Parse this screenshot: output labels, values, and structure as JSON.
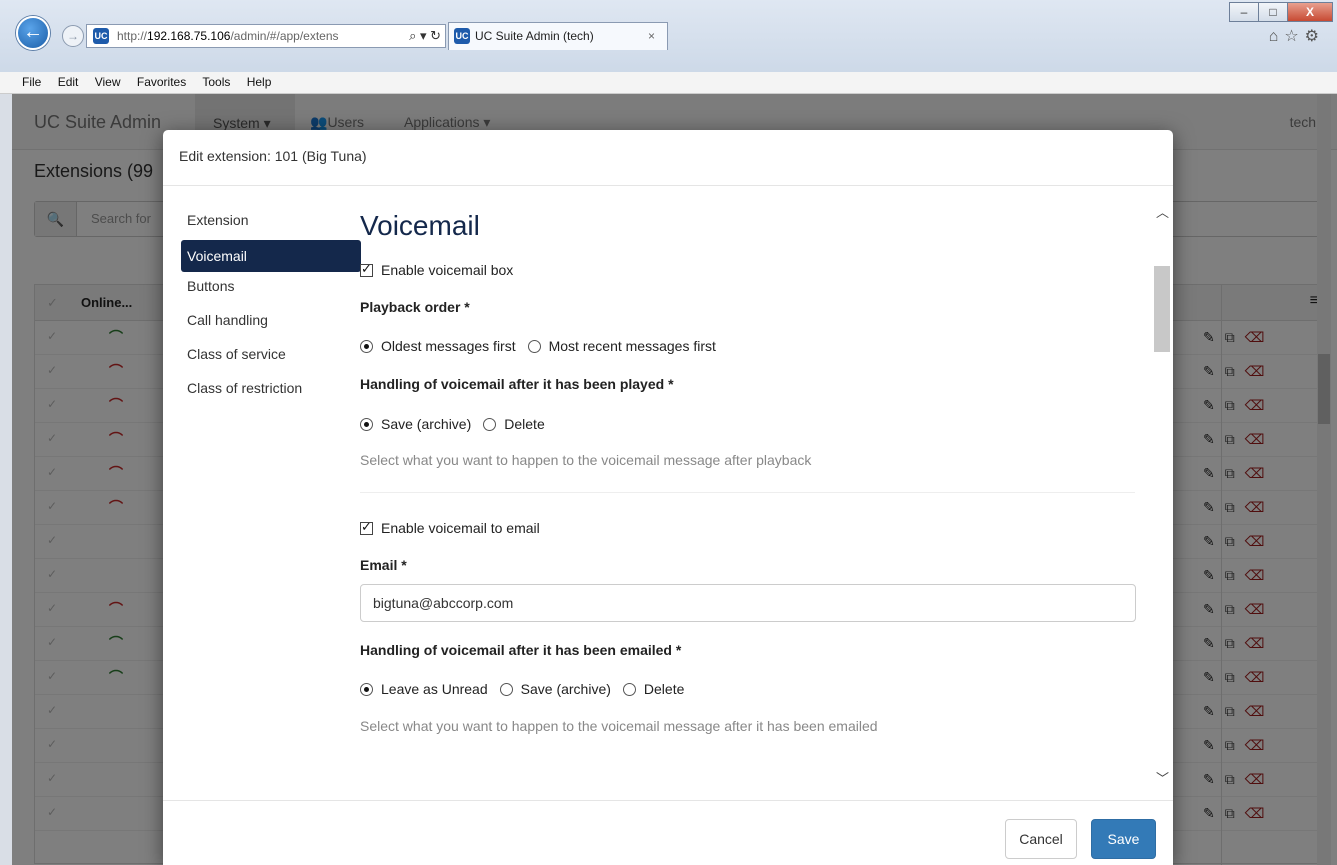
{
  "browser": {
    "url_prefix": "http://",
    "url_host": "192.168.75.106",
    "url_rest": "/admin/#/app/extens",
    "tab_title": "UC Suite Admin (tech)",
    "tab_close": "×",
    "addr_tools": "⌕ ▾ ↻",
    "win_minimize": "–",
    "win_maximize": "□",
    "win_close": "X",
    "menu": [
      "File",
      "Edit",
      "View",
      "Favorites",
      "Tools",
      "Help"
    ]
  },
  "page": {
    "brand": "UC Suite Admin",
    "nav_system": "System ▾",
    "nav_users": "Users",
    "nav_apps": "Applications ▾",
    "nav_user": "tech ▾",
    "title": "Extensions (99",
    "search_placeholder": "Search for",
    "col_online": "Online...",
    "rows": [
      {
        "status": "green"
      },
      {
        "status": "red"
      },
      {
        "status": "red"
      },
      {
        "status": "red"
      },
      {
        "status": "red"
      },
      {
        "status": "red"
      },
      {
        "status": ""
      },
      {
        "status": ""
      },
      {
        "status": "red"
      },
      {
        "status": "green"
      },
      {
        "status": "green"
      },
      {
        "status": ""
      },
      {
        "status": ""
      },
      {
        "status": ""
      },
      {
        "status": ""
      }
    ]
  },
  "modal": {
    "header": "Edit extension: 101 (Big Tuna)",
    "nav": [
      "Extension",
      "Voicemail",
      "Buttons",
      "Call handling",
      "Class of service",
      "Class of restriction"
    ],
    "active_nav": "Voicemail",
    "section_title": "Voicemail",
    "enable_voicemail_box": "Enable voicemail box",
    "playback_order_label": "Playback order *",
    "playback_options": [
      "Oldest messages first",
      "Most recent messages first"
    ],
    "played_handling_label": "Handling of voicemail after it has been played *",
    "played_options": [
      "Save (archive)",
      "Delete"
    ],
    "played_help": "Select what you want to happen to the voicemail message after playback",
    "enable_voicemail_email": "Enable voicemail to email",
    "email_label": "Email *",
    "email_value": "bigtuna@abccorp.com",
    "emailed_handling_label": "Handling of voicemail after it has been emailed *",
    "emailed_options": [
      "Leave as Unread",
      "Save (archive)",
      "Delete"
    ],
    "emailed_help": "Select what you want to happen to the voicemail message after it has been emailed",
    "cancel": "Cancel",
    "save": "Save"
  },
  "colors": {
    "accent_navy": "#14284b",
    "primary_button": "#337ab7",
    "status_green": "#2e7d32",
    "status_red": "#c62828"
  }
}
